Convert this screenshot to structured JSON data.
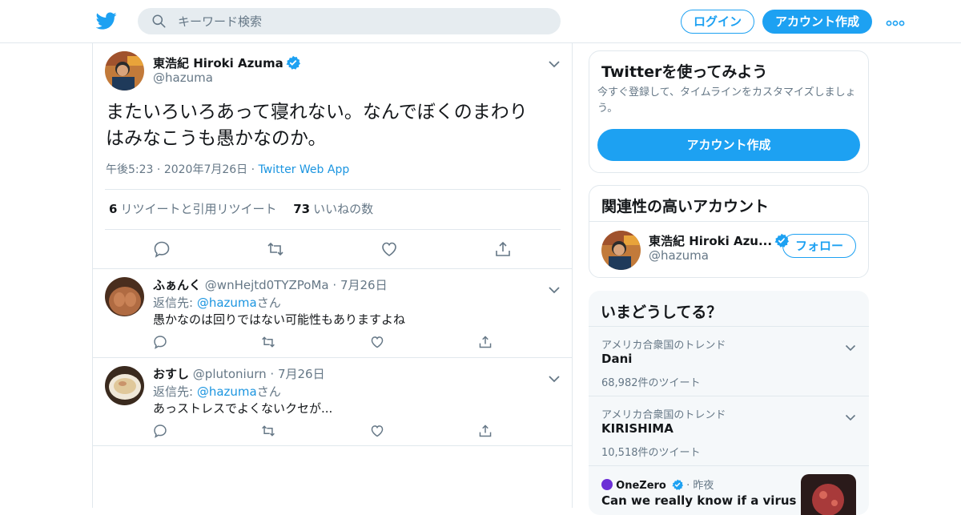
{
  "header": {
    "search_placeholder": "キーワード検索",
    "login_label": "ログイン",
    "signup_label": "アカウント作成",
    "accent": "#1da1f2"
  },
  "tweet": {
    "name": "東浩紀 Hiroki Azuma",
    "handle": "@hazuma",
    "text_line1": "またいろいろあって寝れない。なんでぼくのまわり",
    "text_line2": "はみなこうも愚かなのか。",
    "time": "午後5:23",
    "date": "2020年7月26日",
    "source": "Twitter Web App",
    "retweets": "6",
    "retweets_label": "リツイートと引用リツイート",
    "likes": "73",
    "likes_label": "いいねの数"
  },
  "replies": [
    {
      "name": "ふぁんく",
      "handle": "@wnHejtd0TYZPoMa",
      "date": "7月26日",
      "reply_prefix": "返信先:",
      "reply_to": "@hazuma",
      "reply_suffix": "さん",
      "text": "愚かなのは回りではない可能性もありますよね"
    },
    {
      "name": "おすし",
      "handle": "@plutoniurn",
      "date": "7月26日",
      "reply_prefix": "返信先:",
      "reply_to": "@hazuma",
      "reply_suffix": "さん",
      "text": "あっストレスでよくないクセが..."
    }
  ],
  "sidebar": {
    "signup_card": {
      "title": "Twitterを使ってみよう",
      "subtitle": "今すぐ登録して、タイムラインをカスタマイズしましょう。",
      "button": "アカウント作成"
    },
    "related": {
      "title": "関連性の高いアカウント",
      "name": "東浩紀 Hiroki Azu...",
      "handle": "@hazuma",
      "follow": "フォロー"
    },
    "trends": {
      "title": "いまどうしてる？",
      "items": [
        {
          "location": "アメリカ合衆国のトレンド",
          "name": "Dani",
          "count": "68,982件のツイート"
        },
        {
          "location": "アメリカ合衆国のトレンド",
          "name": "KIRISHIMA",
          "count": "10,518件のツイート"
        }
      ],
      "news": {
        "source": "OneZero",
        "time": "昨夜",
        "headline": "Can we really know if a virus was"
      }
    }
  }
}
